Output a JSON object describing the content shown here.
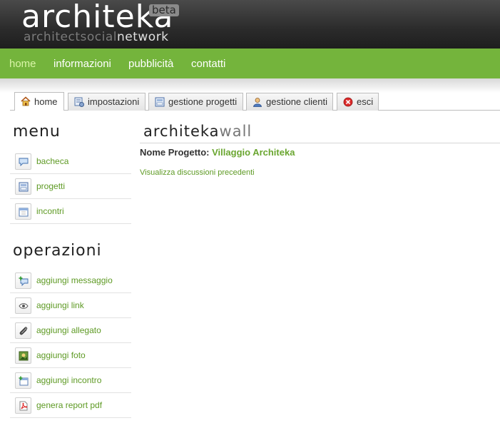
{
  "logo": {
    "main": "architeka",
    "beta": "beta",
    "sub_a": "architect",
    "sub_b": "social",
    "sub_c": "network"
  },
  "topnav": [
    {
      "label": "home",
      "active": true
    },
    {
      "label": "informazioni"
    },
    {
      "label": "pubblicità"
    },
    {
      "label": "contatti"
    }
  ],
  "tabs": [
    {
      "label": "home",
      "icon": "house-icon",
      "active": true
    },
    {
      "label": "impostazioni",
      "icon": "settings-icon"
    },
    {
      "label": "gestione progetti",
      "icon": "projects-icon"
    },
    {
      "label": "gestione clienti",
      "icon": "user-icon"
    },
    {
      "label": "esci",
      "icon": "exit-icon"
    }
  ],
  "sidebar": {
    "menu_title": "menu",
    "menu": [
      {
        "label": "bacheca",
        "icon": "speech-bubble-icon"
      },
      {
        "label": "progetti",
        "icon": "projects-icon"
      },
      {
        "label": "incontri",
        "icon": "calendar-icon"
      }
    ],
    "ops_title": "operazioni",
    "ops": [
      {
        "label": "aggiungi messaggio",
        "icon": "add-message-icon"
      },
      {
        "label": "aggiungi link",
        "icon": "eye-icon"
      },
      {
        "label": "aggiungi allegato",
        "icon": "paperclip-icon"
      },
      {
        "label": "aggiungi foto",
        "icon": "photo-icon"
      },
      {
        "label": "aggiungi incontro",
        "icon": "add-calendar-icon"
      },
      {
        "label": "genera report pdf",
        "icon": "pdf-icon"
      }
    ]
  },
  "main": {
    "wall_title_a": "architeka",
    "wall_title_b": "wall",
    "project_label": "Nome Progetto:",
    "project_value": "Villaggio Architeka",
    "previous_link": "Visualizza discussioni precedenti"
  },
  "colors": {
    "nav_green": "#74b43c",
    "link_green": "#5e9a24",
    "header_dark": "#2b2b2b"
  }
}
